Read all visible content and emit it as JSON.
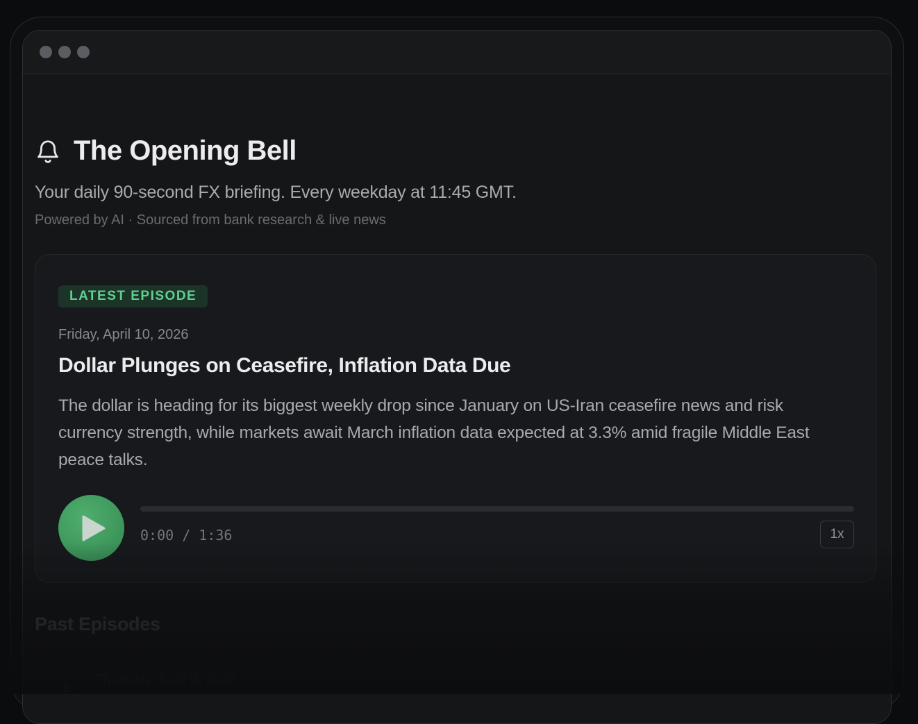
{
  "header": {
    "title": "The Opening Bell",
    "tagline": "Your daily 90-second FX briefing. Every weekday at 11:45 GMT.",
    "powered_by": "Powered by AI · Sourced from bank research & live news",
    "icon": "bell-icon"
  },
  "latest": {
    "badge": "LATEST EPISODE",
    "date": "Friday, April 10, 2026",
    "title": "Dollar Plunges on Ceasefire, Inflation Data Due",
    "description": "The dollar is heading for its biggest weekly drop since January on US-Iran ceasefire news and risk currency strength, while markets await March inflation data expected at 3.3% amid fragile Middle East peace talks.",
    "player": {
      "time": "0:00 / 1:36",
      "speed": "1x",
      "progress": 0
    }
  },
  "past": {
    "heading": "Past Episodes",
    "items": [
      {
        "date": "Thursday, April 9, 2026"
      }
    ]
  },
  "colors": {
    "accent": "#3f9d60",
    "badge_text": "#5fd08e",
    "background": "#151618"
  }
}
